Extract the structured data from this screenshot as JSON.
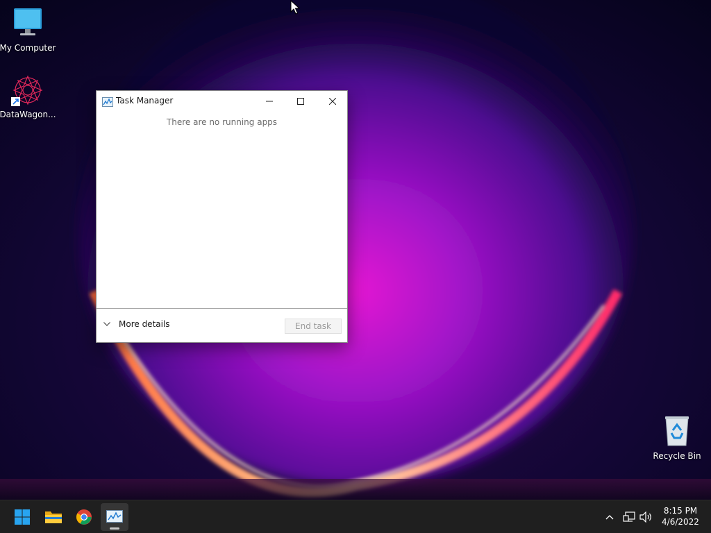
{
  "desktop": {
    "icons": [
      {
        "label": "My Computer",
        "icon": "monitor-icon"
      },
      {
        "label": "DataWagon...",
        "icon": "datawagon-shortcut-icon"
      },
      {
        "label": "Recycle Bin",
        "icon": "recycle-bin-icon"
      }
    ]
  },
  "task_manager": {
    "title": "Task Manager",
    "empty_message": "There are no running apps",
    "more_details_label": "More details",
    "end_task_label": "End task"
  },
  "taskbar": {
    "items": [
      {
        "name": "start",
        "icon": "windows-logo-icon"
      },
      {
        "name": "file-explorer",
        "icon": "folder-icon"
      },
      {
        "name": "chrome",
        "icon": "chrome-icon"
      },
      {
        "name": "task-manager",
        "icon": "task-manager-icon",
        "active": true
      }
    ],
    "tray": {
      "icons": [
        "chevron-up-icon",
        "network-icon",
        "volume-icon"
      ],
      "time": "8:15 PM",
      "date": "4/6/2022"
    }
  },
  "colors": {
    "taskbar": "#1f1f1f",
    "window_bg": "#ffffff",
    "accent_blue": "#0a84d6"
  }
}
